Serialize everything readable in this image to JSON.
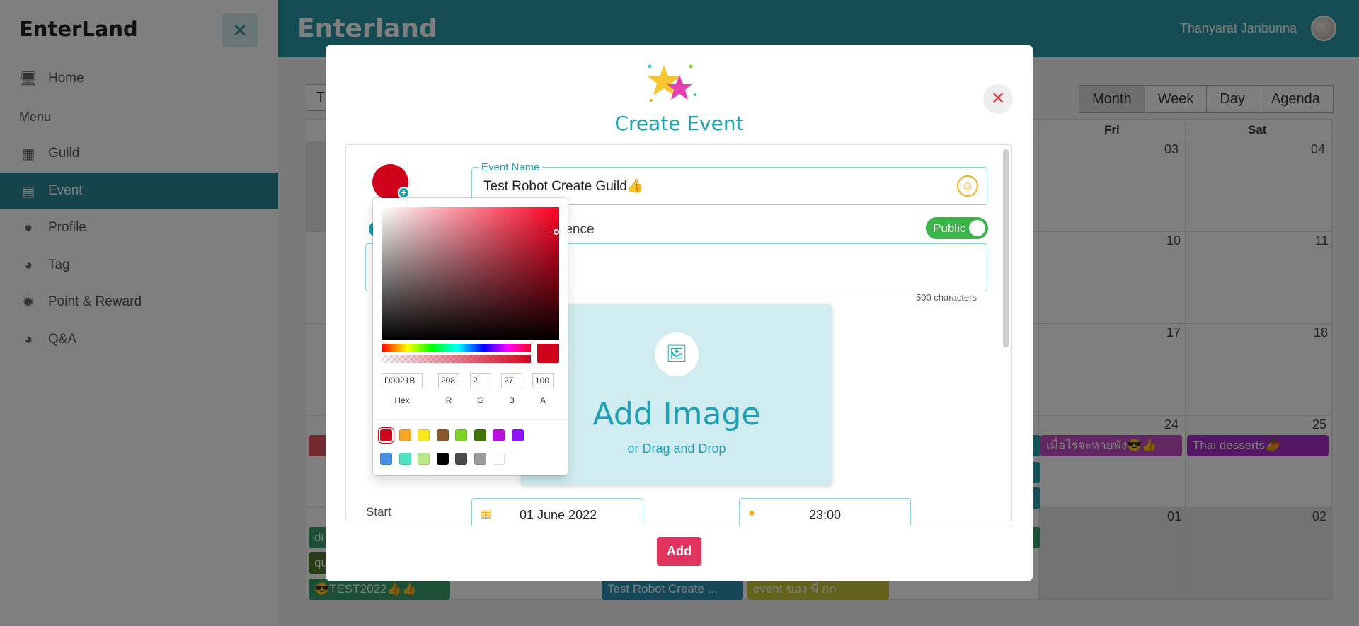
{
  "app": {
    "brand": "EnterLand",
    "title": "Enterland",
    "user": "Thanyarat Janbunna"
  },
  "sidebar": {
    "close": "✕",
    "home": "Home",
    "section": "Menu",
    "items": [
      {
        "label": "Guild",
        "icon": "guild-icon"
      },
      {
        "label": "Event",
        "icon": "event-icon"
      },
      {
        "label": "Profile",
        "icon": "profile-icon"
      },
      {
        "label": "Tag",
        "icon": "tag-icon"
      },
      {
        "label": "Point & Reward",
        "icon": "reward-icon"
      },
      {
        "label": "Q&A",
        "icon": "qa-icon"
      }
    ]
  },
  "calendar": {
    "today_partial": "T",
    "views": [
      "Month",
      "Week",
      "Day",
      "Agenda"
    ],
    "days": [
      "Fri",
      "Sat"
    ],
    "dates": [
      "03",
      "04",
      "10",
      "11",
      "17",
      "18",
      "24",
      "25",
      "01",
      "02"
    ],
    "events": [
      "เมื่อไร่จะหายพัง😎👍",
      "Thai desserts🥭",
      "😎TEST2022👍👍",
      "Test Robot Create ...",
      "event ของ พี่ กก",
      "di",
      "qu"
    ]
  },
  "modal": {
    "title": "Create Event",
    "close": "✕",
    "event_name_label": "Event Name",
    "event_name_value": "Test Robot Create Guild👍",
    "reference_partial": "rence",
    "public_label": "Public",
    "char_count": "500 characters",
    "add_image_title": "Add Image",
    "add_image_sub": "or Drag and Drop",
    "start_label": "Start",
    "start_date": "01 June 2022",
    "start_time": "23:00",
    "add_button": "Add"
  },
  "color_picker": {
    "hex": "D0021B",
    "r": "208",
    "g": "2",
    "b": "27",
    "a": "100",
    "labels": [
      "Hex",
      "R",
      "G",
      "B",
      "A"
    ],
    "current_color": "#d0021b",
    "presets": [
      "#d0021b",
      "#f5a623",
      "#f8e71c",
      "#8b572a",
      "#7ed321",
      "#417505",
      "#bd10e0",
      "#9013fe",
      "#4a90e2",
      "#50e3c2",
      "#b8e986",
      "#000000",
      "#4a4a4a",
      "#9b9b9b",
      "#ffffff"
    ]
  }
}
